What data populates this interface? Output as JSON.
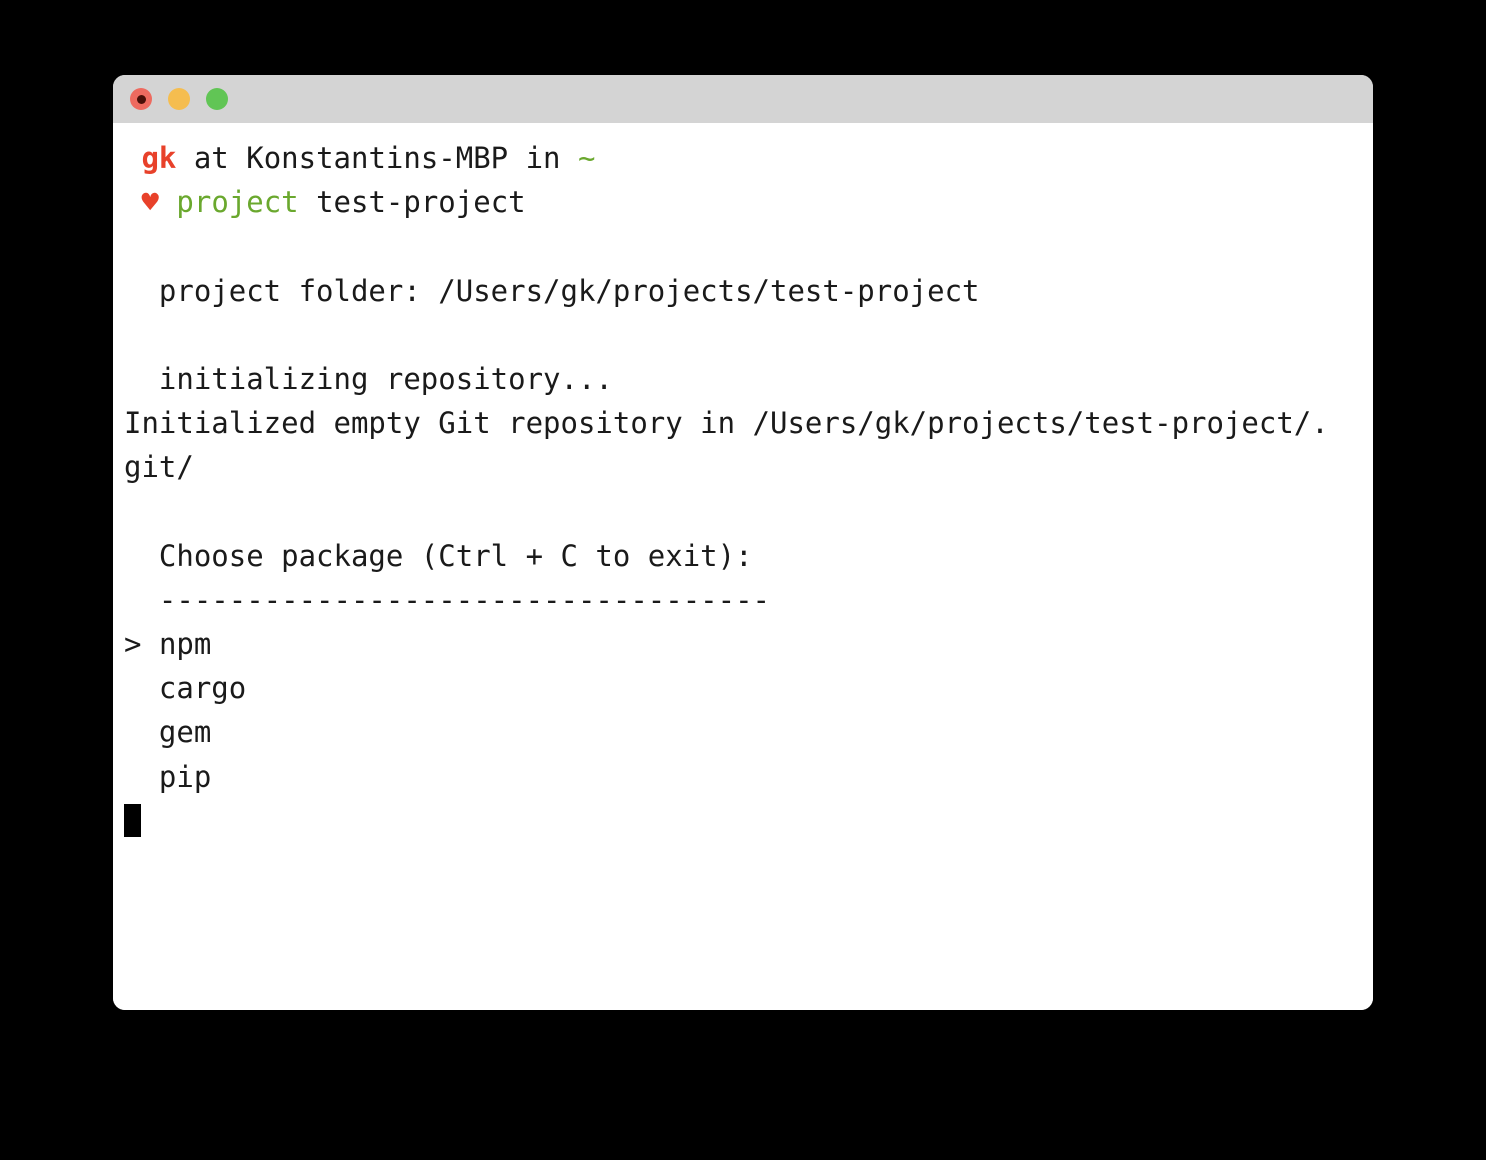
{
  "window": {
    "title_bar": {
      "buttons": [
        {
          "name": "close",
          "color": "#ee6a5f",
          "label": ""
        },
        {
          "name": "minimize",
          "color": "#f5bd4f",
          "label": ""
        },
        {
          "name": "zoom",
          "color": "#61c555",
          "label": ""
        }
      ]
    },
    "background": "#ffffff",
    "chrome_color": "#d4d4d4"
  },
  "colors": {
    "prompt_user": "#e8412a",
    "prompt_accent": "#6aa82e",
    "text": "#1a1a1a",
    "cursor": "#000000"
  },
  "terminal": {
    "prompt": {
      "user": "gk",
      "at": " at ",
      "host": "Konstantins-MBP",
      "in": " in ",
      "cwd": "~",
      "heart": "♥",
      "command_name": "project",
      "command_arg": "test-project"
    },
    "lines": [
      {
        "type": "blank",
        "text": " "
      },
      {
        "type": "output",
        "text": "  project folder: /Users/gk/projects/test-project"
      },
      {
        "type": "blank",
        "text": " "
      },
      {
        "type": "output",
        "text": "  initializing repository..."
      },
      {
        "type": "output",
        "text": "Initialized empty Git repository in /Users/gk/projects/test-project/."
      },
      {
        "type": "output",
        "text": "git/"
      },
      {
        "type": "blank",
        "text": " "
      },
      {
        "type": "output",
        "text": "  Choose package (Ctrl + C to exit):"
      },
      {
        "type": "output",
        "text": "  -----------------------------------"
      }
    ],
    "menu": {
      "pointer": ">",
      "selected_index": 0,
      "items": [
        {
          "label": "npm",
          "selected": true
        },
        {
          "label": "cargo",
          "selected": false
        },
        {
          "label": "gem",
          "selected": false
        },
        {
          "label": "pip",
          "selected": false
        }
      ]
    },
    "cursor": {
      "glyph": "block",
      "visible": true
    }
  }
}
